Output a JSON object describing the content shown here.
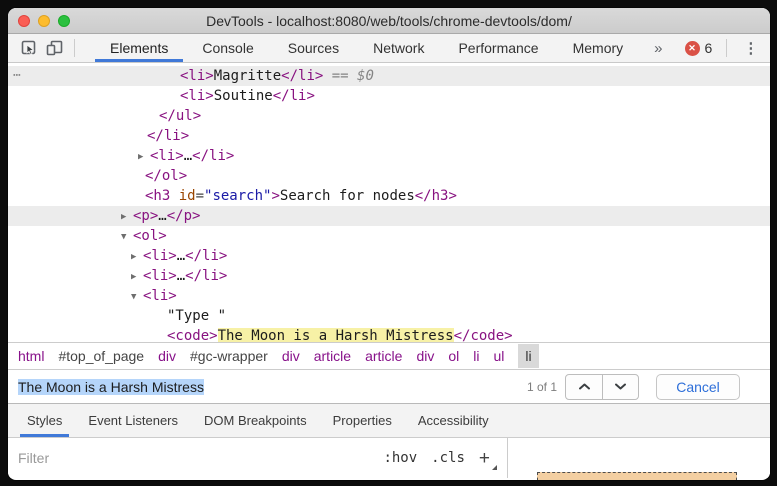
{
  "window": {
    "title": "DevTools - localhost:8080/web/tools/chrome-devtools/dom/"
  },
  "toolbar": {
    "tabs": [
      "Elements",
      "Console",
      "Sources",
      "Network",
      "Performance",
      "Memory"
    ],
    "selected_tab": "Elements",
    "overflow_chevron": "»",
    "error_count": "6",
    "error_icon": "✕",
    "kebab_icon": "⋮"
  },
  "colors": {
    "accent_blue": "#4079d8",
    "error_red": "#da5146",
    "tag_purple": "#881280",
    "attr_orange": "#994500",
    "value_navy": "#1a1aa6",
    "search_highlight": "#f7f1a6",
    "text_selection": "#b5d5fa",
    "margin_box_tan": "#f3cfa2"
  },
  "tree": {
    "rows": [
      {
        "name": "node-li-magritte",
        "indent": 172,
        "arrow": "",
        "band": true,
        "gutter": "⋯",
        "segments": [
          {
            "c": "tag",
            "t": "<li>"
          },
          {
            "c": "text",
            "t": "Magritte"
          },
          {
            "c": "tag",
            "t": "</li>"
          },
          {
            "c": "hint",
            "t": " == $0"
          }
        ]
      },
      {
        "name": "node-li-soutine",
        "indent": 172,
        "arrow": "",
        "band": false,
        "gutter": "",
        "segments": [
          {
            "c": "tag",
            "t": "<li>"
          },
          {
            "c": "text",
            "t": "Soutine"
          },
          {
            "c": "tag",
            "t": "</li>"
          }
        ]
      },
      {
        "name": "node-close-ul",
        "indent": 151,
        "arrow": "",
        "band": false,
        "gutter": "",
        "segments": [
          {
            "c": "tag",
            "t": "</ul>"
          }
        ]
      },
      {
        "name": "node-close-li",
        "indent": 139,
        "arrow": "",
        "band": false,
        "gutter": "",
        "segments": [
          {
            "c": "tag",
            "t": "</li>"
          }
        ]
      },
      {
        "name": "node-li-collapsed",
        "indent": 142,
        "arrow": "▶",
        "band": false,
        "gutter": "",
        "segments": [
          {
            "c": "tag",
            "t": "<li>"
          },
          {
            "c": "text",
            "t": "…"
          },
          {
            "c": "tag",
            "t": "</li>"
          }
        ]
      },
      {
        "name": "node-close-ol",
        "indent": 137,
        "arrow": "",
        "band": false,
        "gutter": "",
        "segments": [
          {
            "c": "tag",
            "t": "</ol>"
          }
        ]
      },
      {
        "name": "node-h3-search",
        "indent": 137,
        "arrow": "",
        "band": false,
        "gutter": "",
        "segments": [
          {
            "c": "tag",
            "t": "<h3 "
          },
          {
            "c": "attr",
            "t": "id"
          },
          {
            "c": "punct",
            "t": "="
          },
          {
            "c": "val",
            "t": "\"search\""
          },
          {
            "c": "tag",
            "t": ">"
          },
          {
            "c": "text",
            "t": "Search for nodes"
          },
          {
            "c": "tag",
            "t": "</h3>"
          }
        ]
      },
      {
        "name": "node-p-collapsed",
        "indent": 125,
        "arrow": "▶",
        "band": true,
        "gutter": "",
        "segments": [
          {
            "c": "tag",
            "t": "<p>"
          },
          {
            "c": "text",
            "t": "…"
          },
          {
            "c": "tag",
            "t": "</p>"
          }
        ]
      },
      {
        "name": "node-ol-expanded",
        "indent": 125,
        "arrow": "▼",
        "band": false,
        "gutter": "",
        "segments": [
          {
            "c": "tag",
            "t": "<ol>"
          }
        ]
      },
      {
        "name": "node-li-collapsed",
        "indent": 135,
        "arrow": "▶",
        "band": false,
        "gutter": "",
        "segments": [
          {
            "c": "tag",
            "t": "<li>"
          },
          {
            "c": "text",
            "t": "…"
          },
          {
            "c": "tag",
            "t": "</li>"
          }
        ]
      },
      {
        "name": "node-li-collapsed",
        "indent": 135,
        "arrow": "▶",
        "band": false,
        "gutter": "",
        "segments": [
          {
            "c": "tag",
            "t": "<li>"
          },
          {
            "c": "text",
            "t": "…"
          },
          {
            "c": "tag",
            "t": "</li>"
          }
        ]
      },
      {
        "name": "node-li-expanded",
        "indent": 135,
        "arrow": "▼",
        "band": false,
        "gutter": "",
        "segments": [
          {
            "c": "tag",
            "t": "<li>"
          }
        ]
      },
      {
        "name": "node-text-type",
        "indent": 159,
        "arrow": "",
        "band": false,
        "gutter": "",
        "segments": [
          {
            "c": "text",
            "t": "\"Type \""
          }
        ]
      },
      {
        "name": "node-code",
        "indent": 159,
        "arrow": "",
        "band": false,
        "gutter": "",
        "segments": [
          {
            "c": "tag",
            "t": "<code>"
          },
          {
            "c": "hl",
            "t": "The Moon is a Harsh Mistress"
          },
          {
            "c": "tag",
            "t": "</code>"
          }
        ]
      }
    ]
  },
  "breadcrumbs": [
    {
      "label": "html",
      "kind": "tag",
      "selected": false
    },
    {
      "label": "#top_of_page",
      "kind": "id",
      "selected": false
    },
    {
      "label": "div",
      "kind": "tag",
      "selected": false
    },
    {
      "label": "#gc-wrapper",
      "kind": "id",
      "selected": false
    },
    {
      "label": "div",
      "kind": "tag",
      "selected": false
    },
    {
      "label": "article",
      "kind": "tag",
      "selected": false
    },
    {
      "label": "article",
      "kind": "tag",
      "selected": false
    },
    {
      "label": "div",
      "kind": "tag",
      "selected": false
    },
    {
      "label": "ol",
      "kind": "tag",
      "selected": false
    },
    {
      "label": "li",
      "kind": "tag",
      "selected": false
    },
    {
      "label": "ul",
      "kind": "tag",
      "selected": false
    },
    {
      "label": "li",
      "kind": "tag",
      "selected": true
    }
  ],
  "search": {
    "value": "The Moon is a Harsh Mistress",
    "match_count": "1 of 1",
    "cancel_label": "Cancel"
  },
  "styles_panel": {
    "tabs": [
      "Styles",
      "Event Listeners",
      "DOM Breakpoints",
      "Properties",
      "Accessibility"
    ],
    "selected_tab": "Styles",
    "filter_placeholder": "Filter",
    "pseudo_toggle": ":hov",
    "class_toggle": ".cls",
    "new_rule_label": "+"
  }
}
